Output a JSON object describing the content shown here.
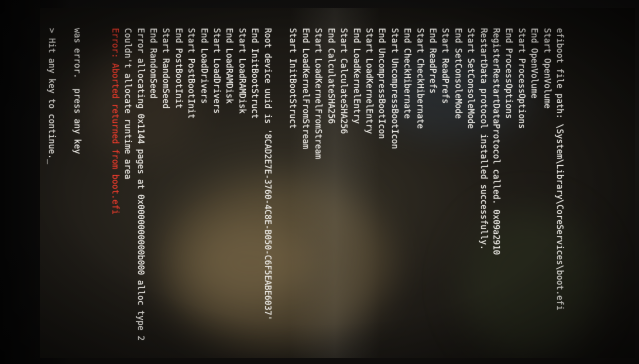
{
  "console": {
    "lines": [
      {
        "text": "efiboot file path: \\System\\Library\\CoreServices\\boot.efi",
        "kind": "normal"
      },
      {
        "text": "Start OpenVolume",
        "kind": "normal"
      },
      {
        "text": "End OpenVolume",
        "kind": "normal"
      },
      {
        "text": "Start ProcessOptions",
        "kind": "normal"
      },
      {
        "text": "End ProcessOptions",
        "kind": "normal"
      },
      {
        "text": "RegisterRestartDataProtocol called. 0x09a2910",
        "kind": "normal"
      },
      {
        "text": "RestartData protocol installed successfully.",
        "kind": "normal"
      },
      {
        "text": "Start SetConsoleMode",
        "kind": "normal"
      },
      {
        "text": "End SetConsoleMode",
        "kind": "normal"
      },
      {
        "text": "Start ReadPrefs",
        "kind": "normal"
      },
      {
        "text": "End ReadPrefs",
        "kind": "normal"
      },
      {
        "text": "Start CheckHibernate",
        "kind": "normal"
      },
      {
        "text": "End CheckHibernate",
        "kind": "normal"
      },
      {
        "text": "Start UncompressBootIcon",
        "kind": "normal"
      },
      {
        "text": "End UncompressBootIcon",
        "kind": "normal"
      },
      {
        "text": "Start LoadKernelEntry",
        "kind": "normal"
      },
      {
        "text": "End LoadKernelEntry",
        "kind": "normal"
      },
      {
        "text": "Start CalculateSHA256",
        "kind": "normal"
      },
      {
        "text": "End CalculateSHA256",
        "kind": "normal"
      },
      {
        "text": "Start LoadKernelFromStream",
        "kind": "normal"
      },
      {
        "text": "End LoadKernelFromStream",
        "kind": "normal"
      },
      {
        "text": "Start InitBootStruct",
        "kind": "normal"
      },
      {
        "text": "",
        "kind": "blank"
      },
      {
        "text": "Root device uuid is '8CAD2E7E-3760-4C8E-B050-C6F5EABE6037'",
        "kind": "normal"
      },
      {
        "text": "End InitBootStruct",
        "kind": "normal"
      },
      {
        "text": "Start LoadRAMDisk",
        "kind": "normal"
      },
      {
        "text": "End LoadRAMDisk",
        "kind": "normal"
      },
      {
        "text": "Start LoadDrivers",
        "kind": "normal"
      },
      {
        "text": "End LoadDrivers",
        "kind": "normal"
      },
      {
        "text": "Start PostBootInit",
        "kind": "normal"
      },
      {
        "text": "End PostBootInit",
        "kind": "normal"
      },
      {
        "text": "Start RandomSeed",
        "kind": "normal"
      },
      {
        "text": "End RandomSeed",
        "kind": "normal"
      },
      {
        "text": "Error allocating 0x1144 pages at 0x0000000000b000 alloc type 2",
        "kind": "normal"
      },
      {
        "text": "Couldn't allocate runtime area",
        "kind": "normal"
      },
      {
        "text": "Error: Aborted returned from boot.efi",
        "kind": "error"
      },
      {
        "text": "",
        "kind": "blank"
      },
      {
        "text": "",
        "kind": "blank"
      },
      {
        "text": "was error.  press any key",
        "kind": "normal"
      },
      {
        "text": "",
        "kind": "blank"
      },
      {
        "text": "> Hit any key to continue.",
        "kind": "normal"
      }
    ],
    "cursor": "_",
    "colors": {
      "text": "#e8e6e0",
      "error": "#e23a2c",
      "background": "#1f1c17"
    }
  }
}
